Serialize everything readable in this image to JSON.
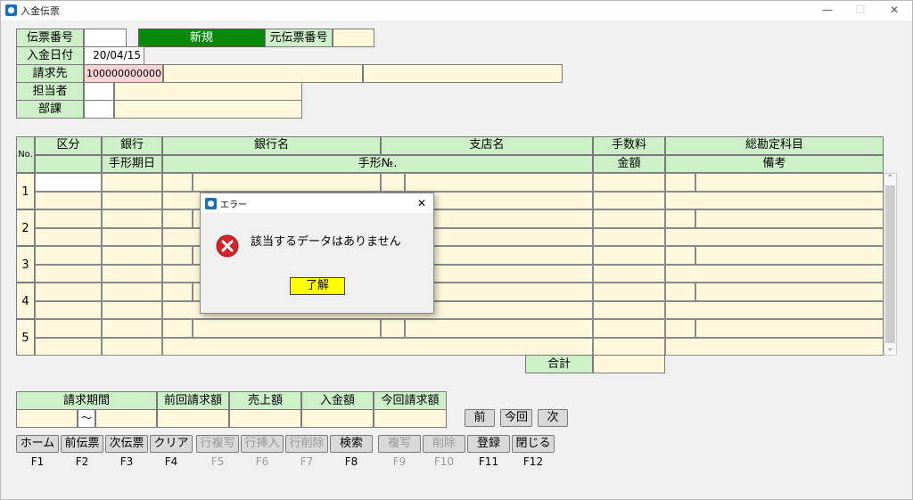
{
  "window": {
    "title": "入金伝票",
    "minimize": "—",
    "maximize": "☐",
    "close": "✕"
  },
  "header": {
    "denpyo_no_label": "伝票番号",
    "denpyo_no_value": "",
    "mode_label": "新規",
    "orig_denpyo_label": "元伝票番号",
    "orig_denpyo_value": "",
    "date_label": "入金日付",
    "date_value": "20/04/15",
    "billto_label": "請求先",
    "billto_value": "100000000000",
    "staff_label": "担当者",
    "dept_label": "部課"
  },
  "grid": {
    "no_label": "No.",
    "columns_top": [
      "区分",
      "銀行",
      "銀行名",
      "支店名",
      "手数料",
      "総勘定科目"
    ],
    "columns_bottom": [
      "手形期日",
      "手形№.",
      "金額",
      "備考"
    ],
    "rows": [
      "1",
      "2",
      "3",
      "4",
      "5"
    ],
    "total_label": "合計",
    "scroll_up": "⌃",
    "scroll_down": "⌄"
  },
  "summary": {
    "period_label": "請求期間",
    "tilde": "〜",
    "prev_bill_label": "前回請求額",
    "sales_label": "売上額",
    "payment_label": "入金額",
    "curr_bill_label": "今回請求額"
  },
  "nav": {
    "prev": "前",
    "current": "今回",
    "next": "次"
  },
  "fbuttons": [
    {
      "label": "ホーム",
      "key": "F1",
      "enabled": true
    },
    {
      "label": "前伝票",
      "key": "F2",
      "enabled": true
    },
    {
      "label": "次伝票",
      "key": "F3",
      "enabled": true
    },
    {
      "label": "クリア",
      "key": "F4",
      "enabled": true
    },
    {
      "label": "行複写",
      "key": "F5",
      "enabled": false
    },
    {
      "label": "行挿入",
      "key": "F6",
      "enabled": false
    },
    {
      "label": "行削除",
      "key": "F7",
      "enabled": false
    },
    {
      "label": "検索",
      "key": "F8",
      "enabled": true
    },
    {
      "label": "複写",
      "key": "F9",
      "enabled": false
    },
    {
      "label": "削除",
      "key": "F10",
      "enabled": false
    },
    {
      "label": "登録",
      "key": "F11",
      "enabled": true
    },
    {
      "label": "閉じる",
      "key": "F12",
      "enabled": true
    }
  ],
  "dialog": {
    "title": "エラー",
    "close": "✕",
    "message": "該当するデータはありません",
    "ok_label": "了解",
    "icon": "error-icon"
  },
  "colors": {
    "label_bg": "#cdf0c8",
    "field_bg": "#fff8dc",
    "mode_green": "#0a8a0a",
    "error_red": "#d4242b",
    "ok_yellow": "#ffff00"
  }
}
